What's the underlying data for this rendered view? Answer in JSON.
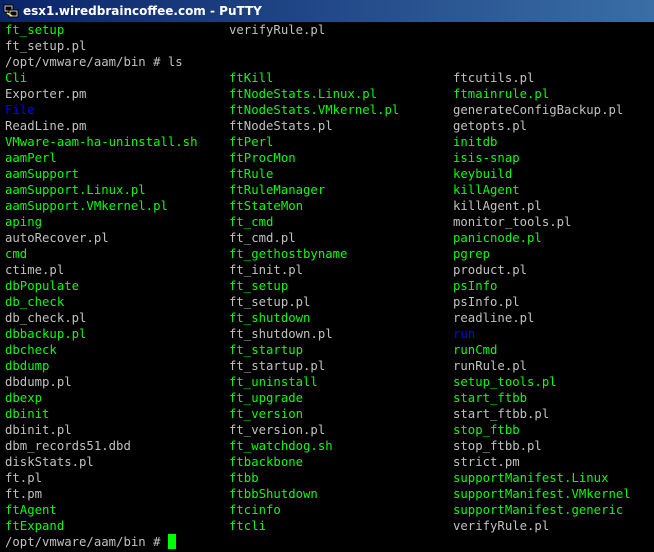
{
  "window": {
    "title": "esx1.wiredbraincoffee.com - PuTTY",
    "icon": "putty-icon"
  },
  "colors": {
    "default": "#c0c0c0",
    "executable": "#00ff00",
    "directory": "#0000ff",
    "cursor": "#00ff00"
  },
  "terminal": {
    "top_lines": [
      [
        {
          "text": "ft_setup",
          "type": "executable"
        },
        {
          "text": "verifyRule.pl",
          "type": "default"
        },
        null
      ],
      [
        {
          "text": "ft_setup.pl",
          "type": "default"
        },
        null,
        null
      ]
    ],
    "prompt": "/opt/vmware/aam/bin # ",
    "command": "ls",
    "listing": [
      [
        {
          "text": "Cli",
          "type": "executable"
        },
        {
          "text": "ftKill",
          "type": "executable"
        },
        {
          "text": "ftcutils.pl",
          "type": "default"
        }
      ],
      [
        {
          "text": "Exporter.pm",
          "type": "default"
        },
        {
          "text": "ftNodeStats.Linux.pl",
          "type": "executable"
        },
        {
          "text": "ftmainrule.pl",
          "type": "executable"
        }
      ],
      [
        {
          "text": "File",
          "type": "directory"
        },
        {
          "text": "ftNodeStats.VMkernel.pl",
          "type": "executable"
        },
        {
          "text": "generateConfigBackup.pl",
          "type": "default"
        }
      ],
      [
        {
          "text": "ReadLine.pm",
          "type": "default"
        },
        {
          "text": "ftNodeStats.pl",
          "type": "default"
        },
        {
          "text": "getopts.pl",
          "type": "default"
        }
      ],
      [
        {
          "text": "VMware-aam-ha-uninstall.sh",
          "type": "executable"
        },
        {
          "text": "ftPerl",
          "type": "executable"
        },
        {
          "text": "initdb",
          "type": "executable"
        }
      ],
      [
        {
          "text": "aamPerl",
          "type": "executable"
        },
        {
          "text": "ftProcMon",
          "type": "executable"
        },
        {
          "text": "isis-snap",
          "type": "executable"
        }
      ],
      [
        {
          "text": "aamSupport",
          "type": "executable"
        },
        {
          "text": "ftRule",
          "type": "executable"
        },
        {
          "text": "keybuild",
          "type": "executable"
        }
      ],
      [
        {
          "text": "aamSupport.Linux.pl",
          "type": "executable"
        },
        {
          "text": "ftRuleManager",
          "type": "executable"
        },
        {
          "text": "killAgent",
          "type": "executable"
        }
      ],
      [
        {
          "text": "aamSupport.VMkernel.pl",
          "type": "executable"
        },
        {
          "text": "ftStateMon",
          "type": "executable"
        },
        {
          "text": "killAgent.pl",
          "type": "default"
        }
      ],
      [
        {
          "text": "aping",
          "type": "executable"
        },
        {
          "text": "ft_cmd",
          "type": "executable"
        },
        {
          "text": "monitor_tools.pl",
          "type": "default"
        }
      ],
      [
        {
          "text": "autoRecover.pl",
          "type": "default"
        },
        {
          "text": "ft_cmd.pl",
          "type": "default"
        },
        {
          "text": "panicnode.pl",
          "type": "executable"
        }
      ],
      [
        {
          "text": "cmd",
          "type": "executable"
        },
        {
          "text": "ft_gethostbyname",
          "type": "executable"
        },
        {
          "text": "pgrep",
          "type": "executable"
        }
      ],
      [
        {
          "text": "ctime.pl",
          "type": "default"
        },
        {
          "text": "ft_init.pl",
          "type": "default"
        },
        {
          "text": "product.pl",
          "type": "default"
        }
      ],
      [
        {
          "text": "dbPopulate",
          "type": "executable"
        },
        {
          "text": "ft_setup",
          "type": "executable"
        },
        {
          "text": "psInfo",
          "type": "executable"
        }
      ],
      [
        {
          "text": "db_check",
          "type": "executable"
        },
        {
          "text": "ft_setup.pl",
          "type": "default"
        },
        {
          "text": "psInfo.pl",
          "type": "default"
        }
      ],
      [
        {
          "text": "db_check.pl",
          "type": "default"
        },
        {
          "text": "ft_shutdown",
          "type": "executable"
        },
        {
          "text": "readline.pl",
          "type": "default"
        }
      ],
      [
        {
          "text": "dbbackup.pl",
          "type": "executable"
        },
        {
          "text": "ft_shutdown.pl",
          "type": "default"
        },
        {
          "text": "run",
          "type": "directory"
        }
      ],
      [
        {
          "text": "dbcheck",
          "type": "executable"
        },
        {
          "text": "ft_startup",
          "type": "executable"
        },
        {
          "text": "runCmd",
          "type": "executable"
        }
      ],
      [
        {
          "text": "dbdump",
          "type": "executable"
        },
        {
          "text": "ft_startup.pl",
          "type": "default"
        },
        {
          "text": "runRule.pl",
          "type": "default"
        }
      ],
      [
        {
          "text": "dbdump.pl",
          "type": "default"
        },
        {
          "text": "ft_uninstall",
          "type": "executable"
        },
        {
          "text": "setup_tools.pl",
          "type": "executable"
        }
      ],
      [
        {
          "text": "dbexp",
          "type": "executable"
        },
        {
          "text": "ft_upgrade",
          "type": "executable"
        },
        {
          "text": "start_ftbb",
          "type": "executable"
        }
      ],
      [
        {
          "text": "dbinit",
          "type": "executable"
        },
        {
          "text": "ft_version",
          "type": "executable"
        },
        {
          "text": "start_ftbb.pl",
          "type": "default"
        }
      ],
      [
        {
          "text": "dbinit.pl",
          "type": "default"
        },
        {
          "text": "ft_version.pl",
          "type": "default"
        },
        {
          "text": "stop_ftbb",
          "type": "executable"
        }
      ],
      [
        {
          "text": "dbm_records51.dbd",
          "type": "default"
        },
        {
          "text": "ft_watchdog.sh",
          "type": "executable"
        },
        {
          "text": "stop_ftbb.pl",
          "type": "default"
        }
      ],
      [
        {
          "text": "diskStats.pl",
          "type": "default"
        },
        {
          "text": "ftbackbone",
          "type": "executable"
        },
        {
          "text": "strict.pm",
          "type": "default"
        }
      ],
      [
        {
          "text": "ft.pl",
          "type": "default"
        },
        {
          "text": "ftbb",
          "type": "executable"
        },
        {
          "text": "supportManifest.Linux",
          "type": "executable"
        }
      ],
      [
        {
          "text": "ft.pm",
          "type": "default"
        },
        {
          "text": "ftbbShutdown",
          "type": "executable"
        },
        {
          "text": "supportManifest.VMkernel",
          "type": "executable"
        }
      ],
      [
        {
          "text": "ftAgent",
          "type": "executable"
        },
        {
          "text": "ftcinfo",
          "type": "executable"
        },
        {
          "text": "supportManifest.generic",
          "type": "executable"
        }
      ],
      [
        {
          "text": "ftExpand",
          "type": "executable"
        },
        {
          "text": "ftcli",
          "type": "executable"
        },
        {
          "text": "verifyRule.pl",
          "type": "default"
        }
      ]
    ],
    "final_prompt": "/opt/vmware/aam/bin # "
  }
}
